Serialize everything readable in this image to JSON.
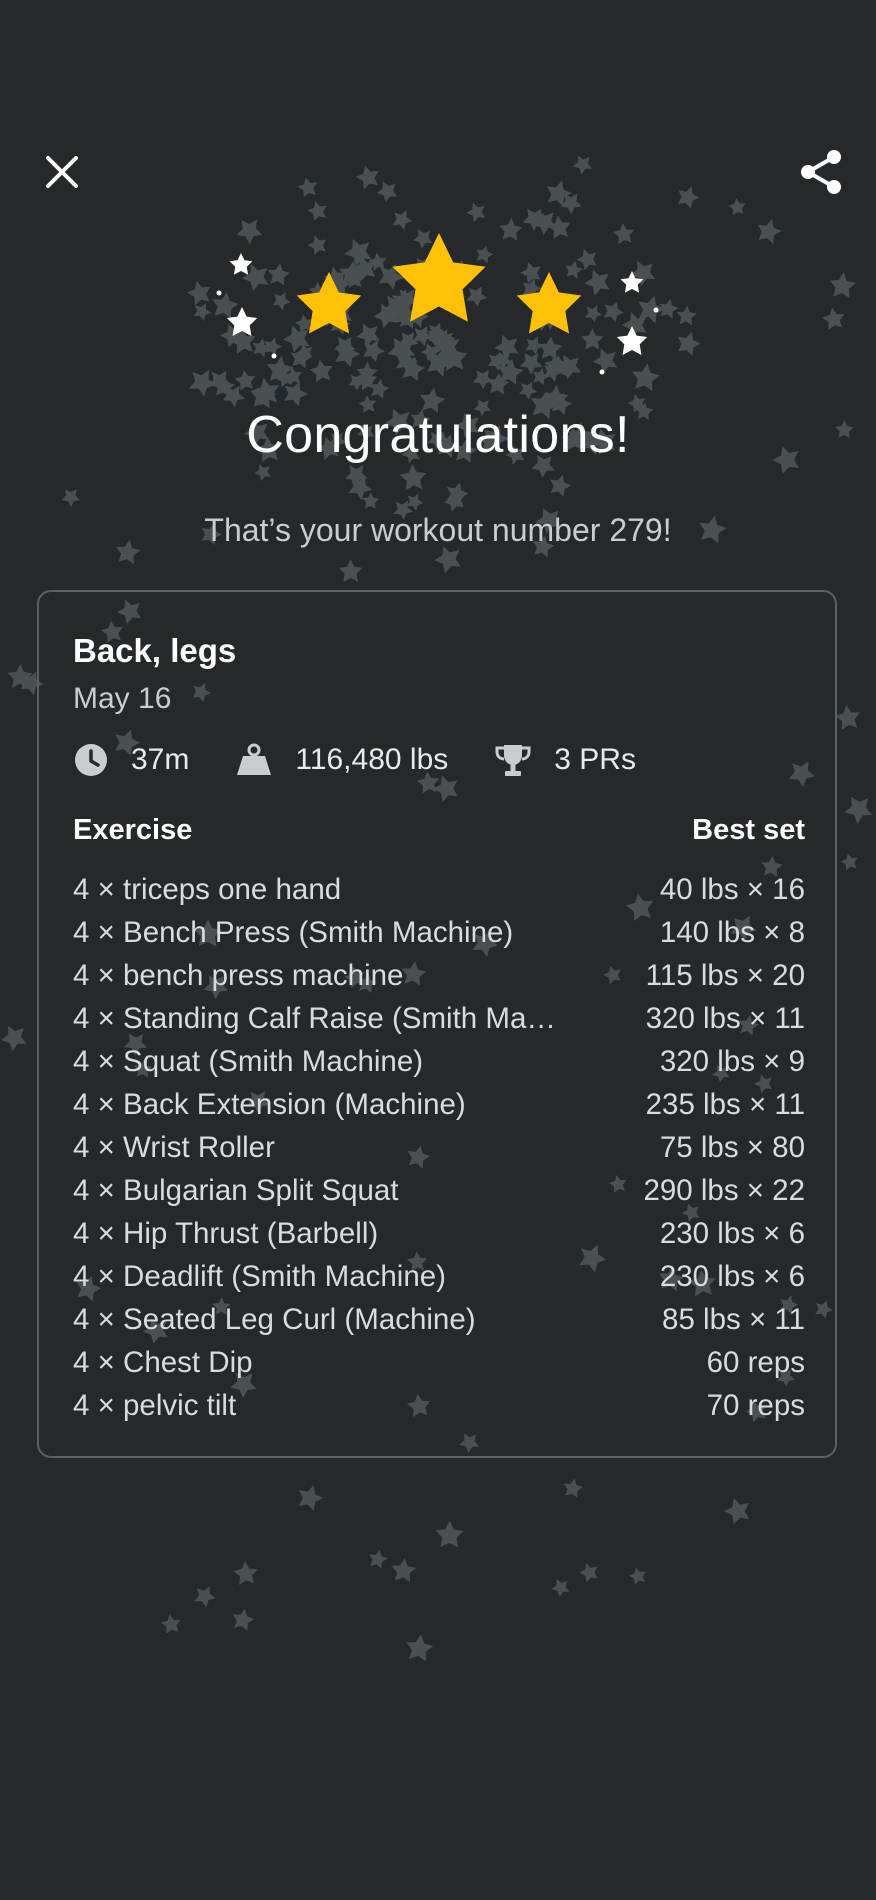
{
  "header": {
    "close_icon": "close-icon",
    "share_icon": "share-icon"
  },
  "rating": {
    "filled_stars": 3,
    "star_color": "#FFC107"
  },
  "congrats": {
    "title": "Congratulations!",
    "subtitle": "That’s your workout number 279!"
  },
  "workout": {
    "name": "Back, legs",
    "date": "May 16",
    "stats": {
      "duration": "37m",
      "volume": "116,480 lbs",
      "prs": "3 PRs"
    },
    "columns": {
      "exercise": "Exercise",
      "best_set": "Best set"
    },
    "exercises": [
      {
        "name": "4 × triceps one hand",
        "best": "40 lbs × 16"
      },
      {
        "name": "4 × Bench Press (Smith Machine)",
        "best": "140 lbs × 8"
      },
      {
        "name": "4 × bench press machine",
        "best": "115 lbs × 20"
      },
      {
        "name": "4 × Standing Calf Raise (Smith Ma…",
        "best": "320 lbs × 11"
      },
      {
        "name": "4 × Squat (Smith Machine)",
        "best": "320 lbs × 9"
      },
      {
        "name": "4 × Back Extension (Machine)",
        "best": "235 lbs × 11"
      },
      {
        "name": "4 × Wrist Roller",
        "best": "75 lbs × 80"
      },
      {
        "name": "4 × Bulgarian Split Squat",
        "best": "290 lbs × 22"
      },
      {
        "name": "4 × Hip Thrust (Barbell)",
        "best": "230 lbs × 6"
      },
      {
        "name": "4 × Deadlift (Smith Machine)",
        "best": "230 lbs × 6"
      },
      {
        "name": "4 × Seated Leg Curl (Machine)",
        "best": "85 lbs × 11"
      },
      {
        "name": "4 × Chest Dip",
        "best": "60 reps"
      },
      {
        "name": "4 × pelvic tilt",
        "best": "70 reps"
      }
    ]
  }
}
